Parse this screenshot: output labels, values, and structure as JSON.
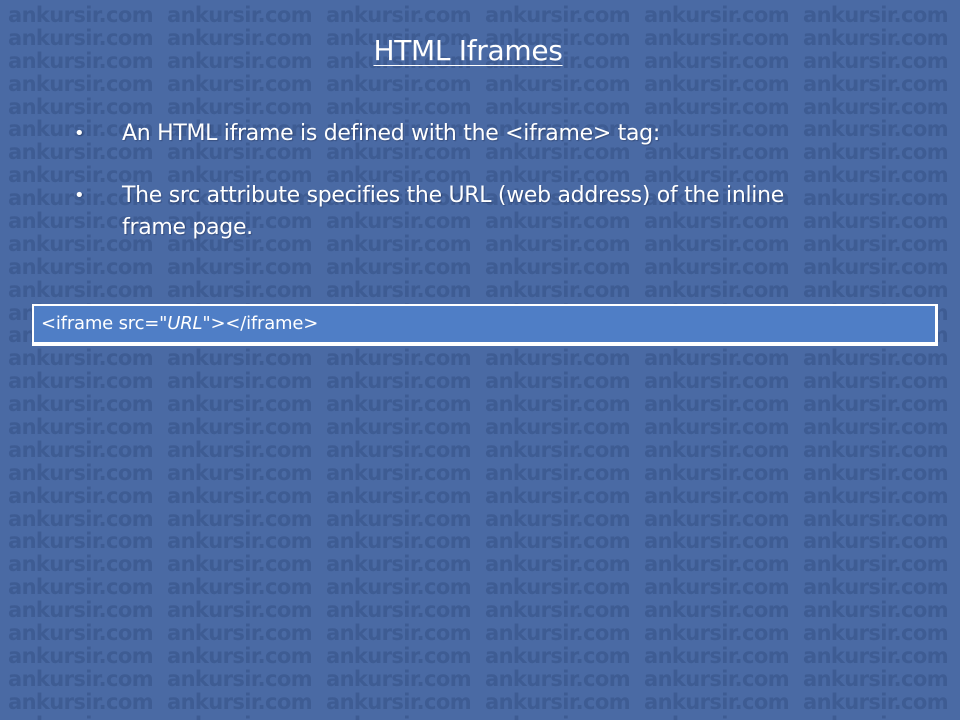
{
  "watermark": {
    "text": "ankursir.com"
  },
  "slide": {
    "title": "HTML  Iframes",
    "bullet_symbol": "•",
    "bullets": [
      "An HTML iframe is defined with the <iframe> tag:",
      "The src attribute specifies the URL (web address) of the inline frame page."
    ]
  },
  "code_example": {
    "prefix": "<iframe src=\"",
    "placeholder": "URL",
    "suffix": "\"></iframe>"
  },
  "colors": {
    "background": "#4a6aa4",
    "watermark": "#3e5c93",
    "code_box": "#4f7ec6",
    "text": "#ffffff"
  }
}
